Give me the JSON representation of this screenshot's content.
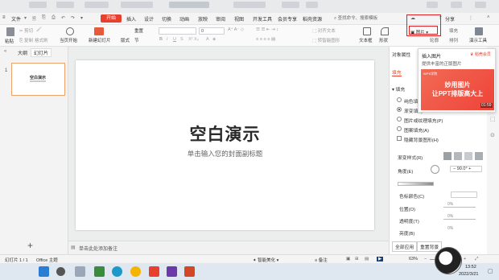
{
  "menu": {
    "file": "文件",
    "tabs": [
      "开始",
      "插入",
      "设计",
      "切换",
      "动画",
      "放映",
      "审阅",
      "视图",
      "开发工具",
      "会员专享",
      "稻壳资源"
    ],
    "search_placeholder": "查找命令、搜索模板",
    "share": "分享"
  },
  "ribbon": {
    "paste": "粘贴",
    "cut": "剪切",
    "copy": "复制",
    "format_painter": "格式刷",
    "play_from_current": "当页开始",
    "new_slide": "新建幻灯片",
    "layout": "版式",
    "section": "节",
    "reset": "重置",
    "font_size": "0",
    "text_box": "文本框",
    "shape": "形状",
    "picture": "图片",
    "fill": "填充",
    "arrange": "排列",
    "outline": "轮廓",
    "ppt_tools": "演示工具",
    "convert_smartart": "转智能图形",
    "align_text": "对齐文本"
  },
  "left_panel": {
    "tab_outline": "大纲",
    "tab_slides": "幻灯片",
    "slide_number": "1",
    "thumb_title": "空白演示",
    "add_slide": "+"
  },
  "slide": {
    "title": "空白演示",
    "subtitle": "单击输入您的封面副标题"
  },
  "notes": {
    "placeholder": "单击此处添加备注"
  },
  "right_panel": {
    "header": "对象属性",
    "tab_fill": "填充",
    "section_fill": "填充",
    "options": [
      "纯色填充",
      "渐变填充",
      "图片或纹理填充(P)",
      "图案填充(A)",
      "隐藏背景图形(H)"
    ],
    "gradient_style": "渐变样式(R)",
    "angle_label": "角度(E)",
    "angle_value": "90.0°",
    "color_stop": "色标颜色(C)",
    "position": "位置(O)",
    "position_value": "0%",
    "transparency": "透明度(T)",
    "transparency_value": "0%",
    "brightness": "亮度(B)",
    "brightness_value": "0%",
    "apply_all": "全部应用",
    "reset_background": "重置背景"
  },
  "popup": {
    "title": "插入图片",
    "desc": "提供丰富的正版图片",
    "vip_badge": "稻壳会员",
    "banner_logo": "WPS学院",
    "banner_line1": "妙用图片",
    "banner_line2": "让PPT排版高大上",
    "duration": "01:59"
  },
  "status_bar": {
    "slide_count": "幻灯片 1 / 1",
    "theme": "Office 主题",
    "smart_beautify": "智能美化",
    "notes": "备注",
    "zoom": "63%"
  },
  "taskbar": {
    "time": "13:52",
    "date": "2022/3/21"
  },
  "colors": {
    "accent": "#e8402d",
    "highlight": "#e02020",
    "selection": "#f0a06a"
  }
}
